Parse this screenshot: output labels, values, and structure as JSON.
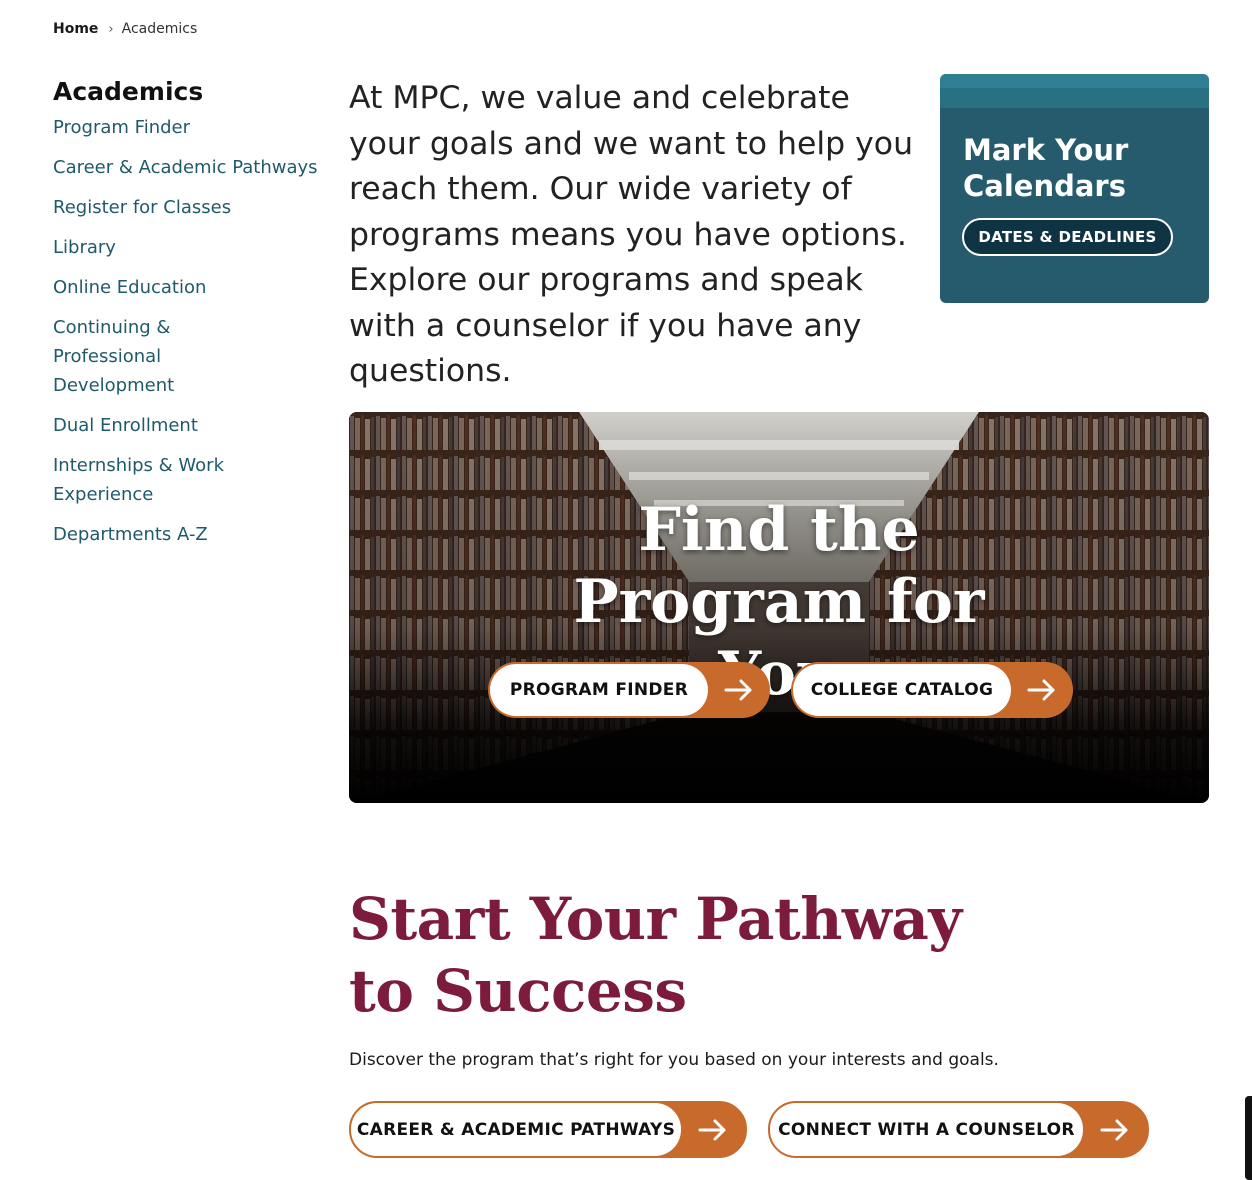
{
  "breadcrumb": {
    "home": "Home",
    "current": "Academics"
  },
  "sidebar": {
    "title": "Academics",
    "items": [
      {
        "label": "Program Finder"
      },
      {
        "label": "Career & Academic Pathways"
      },
      {
        "label": "Register for Classes"
      },
      {
        "label": "Library"
      },
      {
        "label": "Online Education"
      },
      {
        "label": "Continuing & Professional Development"
      },
      {
        "label": "Dual Enrollment"
      },
      {
        "label": "Internships & Work Experience"
      },
      {
        "label": "Departments A-Z"
      }
    ]
  },
  "intro": {
    "text": "At MPC, we value and celebrate your goals and we want to help you reach them. Our wide variety of programs means you have options. Explore our programs and speak with a counselor if you have any questions."
  },
  "calendar": {
    "title": "Mark Your Calendars",
    "button": "DATES & DEADLINES"
  },
  "hero": {
    "title": "Find the Program for You",
    "buttons": {
      "program_finder": "PROGRAM FINDER",
      "college_catalog": "COLLEGE CATALOG"
    }
  },
  "pathway": {
    "title": "Start Your Pathway to Success",
    "description": "Discover the program that’s right for you based on your interests and goals.",
    "buttons": {
      "career": "CAREER & ACADEMIC PATHWAYS",
      "counselor": "CONNECT WITH A COUNSELOR"
    }
  },
  "colors": {
    "accent_orange": "#c86a2c",
    "teal_card": "#265b6d",
    "link_teal": "#1f5a6b",
    "maroon_heading": "#7c1b3c"
  }
}
